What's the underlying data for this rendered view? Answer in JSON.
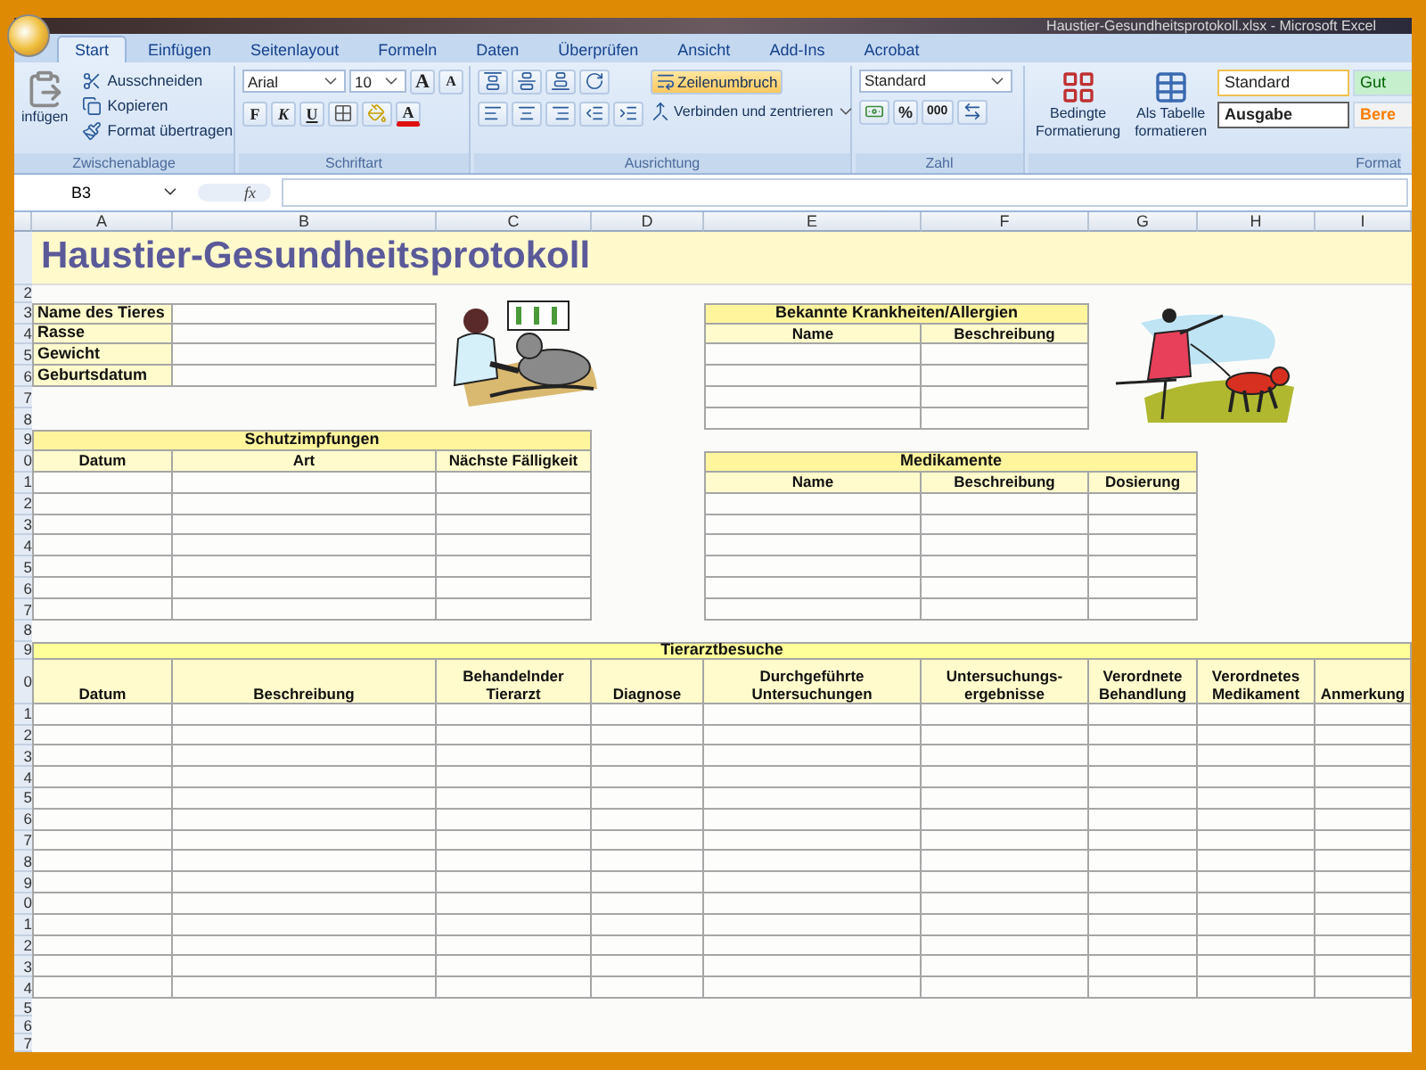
{
  "window": {
    "title": "Haustier-Gesundheitsprotokoll.xlsx - Microsoft Excel"
  },
  "tabs": [
    {
      "label": "Start",
      "selected": true
    },
    {
      "label": "Einfügen",
      "selected": false
    },
    {
      "label": "Seitenlayout",
      "selected": false
    },
    {
      "label": "Formeln",
      "selected": false
    },
    {
      "label": "Daten",
      "selected": false
    },
    {
      "label": "Überprüfen",
      "selected": false
    },
    {
      "label": "Ansicht",
      "selected": false
    },
    {
      "label": "Add-Ins",
      "selected": false
    },
    {
      "label": "Acrobat",
      "selected": false
    }
  ],
  "ribbon": {
    "clipboard": {
      "paste": "infügen",
      "items": [
        "Ausschneiden",
        "Kopieren",
        "Format übertragen"
      ],
      "label": "Zwischenablage"
    },
    "font": {
      "family": "Arial",
      "size": "10",
      "grow": "A",
      "shrink": "A",
      "styles": [
        "F",
        "K",
        "U"
      ],
      "color_letter": "A",
      "label": "Schriftart"
    },
    "alignment": {
      "wrap": {
        "label": "Zeilenumbruch",
        "on": true
      },
      "merge": "Verbinden und zentrieren",
      "label": "Ausrichtung"
    },
    "number": {
      "format": "Standard",
      "percent": "%",
      "thousands": "000",
      "label": "Zahl"
    },
    "styles": {
      "conditional": [
        "Bedingte",
        "Formatierung"
      ],
      "as_table": [
        "Als Tabelle",
        "formatieren"
      ],
      "cells": [
        {
          "label": "Standard",
          "kind": "normal"
        },
        {
          "label": "Gut",
          "kind": "good"
        },
        {
          "label": "Ausgabe",
          "kind": "output"
        },
        {
          "label": "Bere",
          "kind": "calc"
        }
      ],
      "label": "Format"
    }
  },
  "formula_bar": {
    "name_box": "B3",
    "fx": "fx"
  },
  "columns": [
    "A",
    "B",
    "C",
    "D",
    "E",
    "F",
    "G",
    "H",
    "I"
  ],
  "row_numbers": [
    "2",
    "3",
    "4",
    "5",
    "6",
    "7",
    "8",
    "9",
    "0",
    "1",
    "2",
    "3",
    "4",
    "5",
    "6",
    "7",
    "8",
    "9",
    "0",
    "1",
    "2",
    "3",
    "4",
    "5",
    "6",
    "7",
    "8",
    "9",
    "0",
    "1",
    "2",
    "3",
    "4",
    "5",
    "6",
    "7"
  ],
  "sheet": {
    "title": "Haustier-Gesundheitsprotokoll",
    "pet_info": [
      "Name des Tieres",
      "Rasse",
      "Gewicht",
      "Geburtsdatum"
    ],
    "illnesses": {
      "title": "Bekannte Krankheiten/Allergien",
      "columns": [
        "Name",
        "Beschreibung"
      ]
    },
    "vaccinations": {
      "title": "Schutzimpfungen",
      "columns": [
        "Datum",
        "Art",
        "Nächste Fälligkeit"
      ]
    },
    "medications": {
      "title": "Medikamente",
      "columns": [
        "Name",
        "Beschreibung",
        "Dosierung"
      ]
    },
    "vet_visits": {
      "title": "Tierarztbesuche",
      "columns": [
        "Datum",
        "Beschreibung",
        "Behandelnder Tierarzt",
        "Diagnose",
        "Durchgeführte Untersuchungen",
        "Untersuchungs-ergebnisse",
        "Verordnete Behandlung",
        "Verordnetes Medikament",
        "Anmerkung"
      ]
    }
  }
}
